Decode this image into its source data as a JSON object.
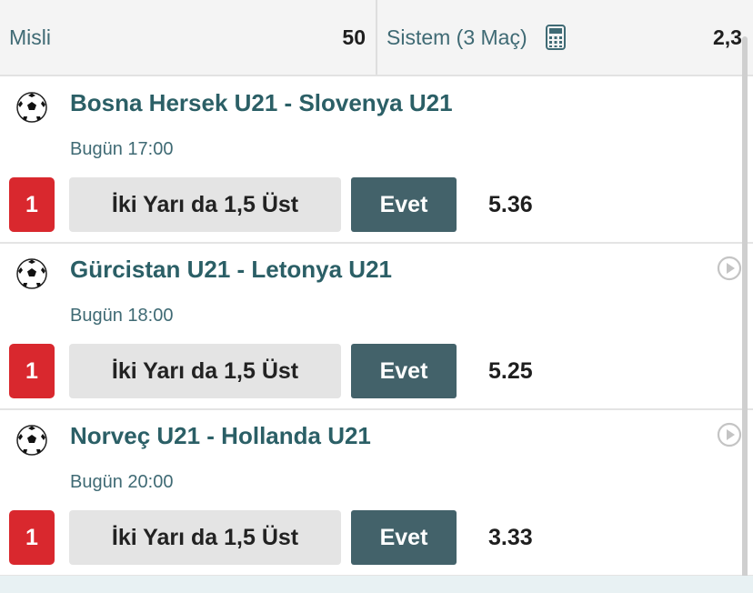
{
  "header": {
    "misli_label": "Misli",
    "misli_value": "50",
    "sistem_label": "Sistem (3 Maç)",
    "sistem_value": "2,3"
  },
  "icons": {
    "sport": "soccer-ball-icon",
    "calculator": "calculator-icon",
    "play": "play-circle-icon"
  },
  "colors": {
    "pick_badge": "#d9282e",
    "selection_button": "#43626a",
    "title_text": "#2b5f66"
  },
  "matches": [
    {
      "title": "Bosna Hersek U21 - Slovenya U21",
      "time": "Bugün 17:00",
      "pick": "1",
      "market": "İki Yarı da 1,5 Üst",
      "selection": "Evet",
      "odds": "5.36"
    },
    {
      "title": "Gürcistan U21 - Letonya U21",
      "time": "Bugün 18:00",
      "pick": "1",
      "market": "İki Yarı da 1,5 Üst",
      "selection": "Evet",
      "odds": "5.25"
    },
    {
      "title": "Norveç U21 - Hollanda U21",
      "time": "Bugün 20:00",
      "pick": "1",
      "market": "İki Yarı da 1,5 Üst",
      "selection": "Evet",
      "odds": "3.33"
    }
  ]
}
